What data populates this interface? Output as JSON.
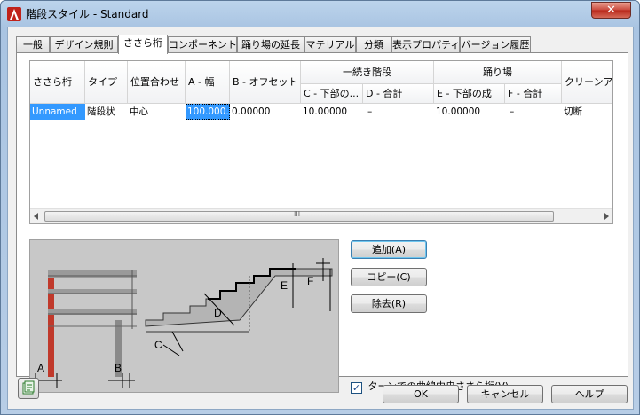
{
  "window": {
    "title": "階段スタイル - Standard",
    "close_glyph": "✕"
  },
  "tabs": [
    {
      "label": "一般"
    },
    {
      "label": "デザイン規則"
    },
    {
      "label": "ささら桁"
    },
    {
      "label": "コンポーネント"
    },
    {
      "label": "踊り場の延長"
    },
    {
      "label": "マテリアル"
    },
    {
      "label": "分類"
    },
    {
      "label": "表示プロパティ"
    },
    {
      "label": "バージョン履歴"
    }
  ],
  "active_tab": "ささら桁",
  "grid": {
    "headers": {
      "stringer": "ささら桁",
      "type": "タイプ",
      "alignment": "位置合わせ",
      "a_width": "A - 幅",
      "b_offset": "B - オフセット",
      "group_flight": "一続き階段",
      "c_rise": "C - 下部の...",
      "d_total": "D - 合計",
      "group_landing": "踊り場",
      "e_rise": "E - 下部の成",
      "f_total": "F - 合計",
      "cleanup": "クリーンアップ"
    },
    "row": {
      "stringer": "Unnamed",
      "type": "階段状",
      "alignment": "中心",
      "a_width": "100.000...",
      "b_offset": "0.00000",
      "c_rise": "10.00000",
      "d_total": "–",
      "e_rise": "10.00000",
      "f_total": "–",
      "cleanup": "切断"
    },
    "scroll_grip": "III"
  },
  "preview_labels": {
    "a": "A",
    "b": "B",
    "c": "C",
    "d": "D",
    "e": "E",
    "f": "F"
  },
  "buttons": {
    "add": "追加(A)",
    "copy": "コピー(C)",
    "remove": "除去(R)",
    "ok": "OK",
    "cancel": "キャンセル",
    "help": "ヘルプ"
  },
  "checkbox": {
    "label": "ターンでの曲線中央ささら桁(V)",
    "checked": true,
    "mark": "✓"
  },
  "colors": {
    "selection": "#3399ff",
    "stringer_red": "#c0392b"
  }
}
